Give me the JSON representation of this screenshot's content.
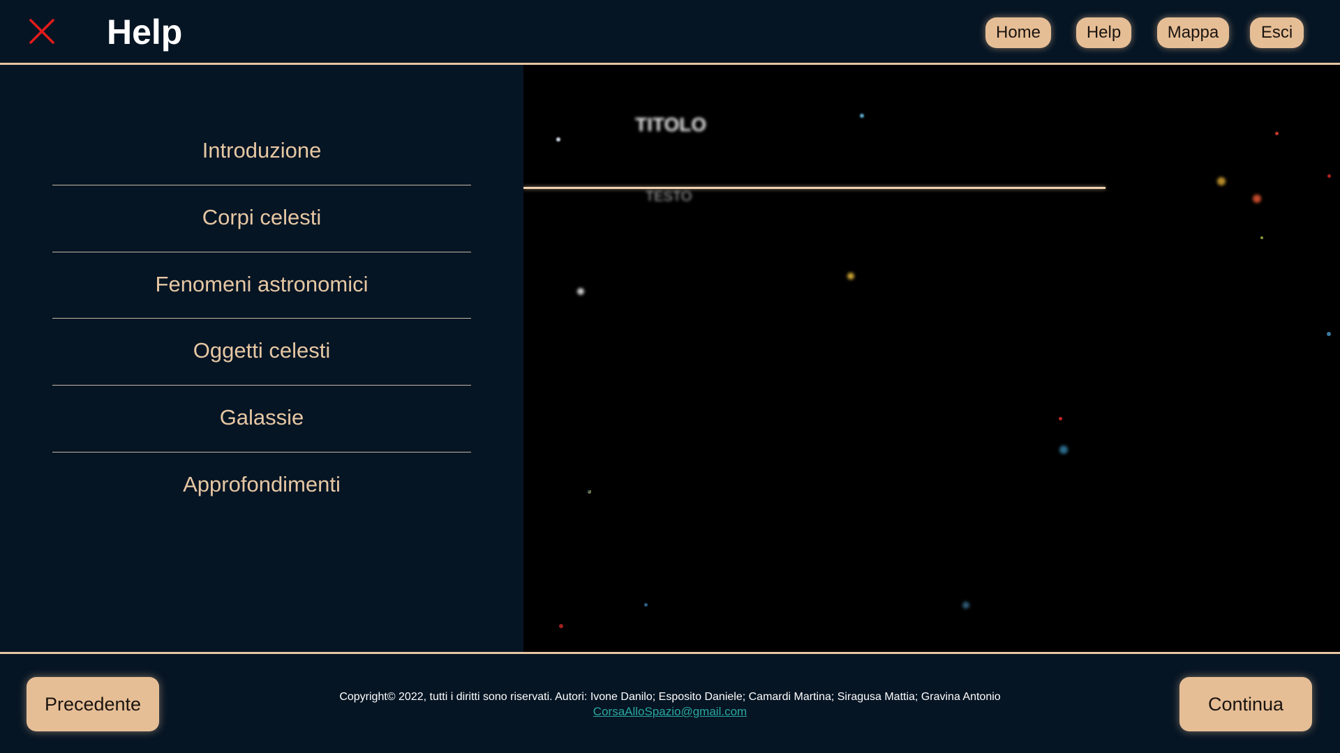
{
  "header": {
    "title": "Help",
    "close_icon": "close-x-icon",
    "close_color": "#e31b1b",
    "nav": [
      {
        "label": "Home"
      },
      {
        "label": "Help"
      },
      {
        "label": "Mappa"
      },
      {
        "label": "Esci"
      }
    ]
  },
  "sidebar": {
    "items": [
      {
        "label": "Introduzione"
      },
      {
        "label": "Corpi celesti"
      },
      {
        "label": "Fenomeni astronomici"
      },
      {
        "label": "Oggetti celesti"
      },
      {
        "label": "Galassie"
      },
      {
        "label": "Approfondimenti"
      }
    ]
  },
  "content": {
    "title": "TITOLO",
    "text": "TESTO"
  },
  "footer": {
    "prev_label": "Precedente",
    "next_label": "Continua",
    "copyright": "Copyright© 2022, tutti i diritti sono riservati. Autori: Ivone Danilo; Esposito Daniele; Camardi Martina; Siragusa Mattia; Gravina Antonio",
    "email": "CorsaAlloSpazio@gmail.com"
  },
  "colors": {
    "background": "#061524",
    "accent": "#e6be96",
    "text_accent": "#e6c7a3",
    "link": "#2aa8a0"
  }
}
